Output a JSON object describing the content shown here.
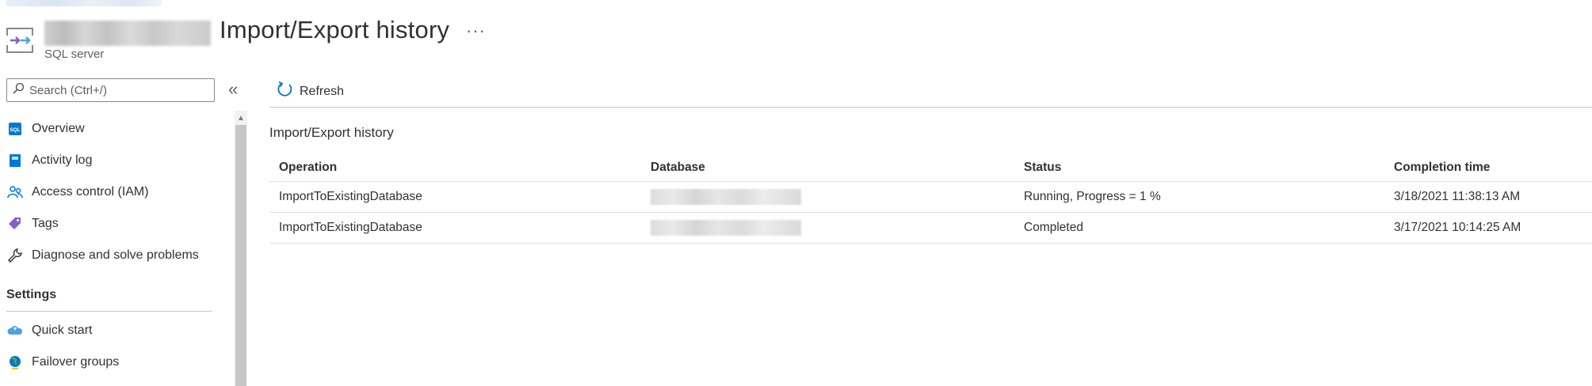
{
  "header": {
    "title": "Import/Export history",
    "resource_type": "SQL server",
    "more_label": "···"
  },
  "sidebar": {
    "search_placeholder": "Search (Ctrl+/)",
    "collapse_label": "«",
    "items": [
      {
        "label": "Overview",
        "icon": "sql-icon"
      },
      {
        "label": "Activity log",
        "icon": "activity-log-icon"
      },
      {
        "label": "Access control (IAM)",
        "icon": "people-icon"
      },
      {
        "label": "Tags",
        "icon": "tag-icon"
      },
      {
        "label": "Diagnose and solve problems",
        "icon": "wrench-icon"
      }
    ],
    "settings_heading": "Settings",
    "settings_items": [
      {
        "label": "Quick start",
        "icon": "cloud-icon"
      },
      {
        "label": "Failover groups",
        "icon": "globe-icon"
      }
    ]
  },
  "toolbar": {
    "refresh_label": "Refresh"
  },
  "history": {
    "section_title": "Import/Export history",
    "columns": [
      "Operation",
      "Database",
      "Status",
      "Completion time"
    ],
    "rows": [
      {
        "operation": "ImportToExistingDatabase",
        "status": "Running, Progress = 1 %",
        "completion_time": "3/18/2021 11:38:13 AM"
      },
      {
        "operation": "ImportToExistingDatabase",
        "status": "Completed",
        "completion_time": "3/17/2021 10:14:25 AM"
      }
    ]
  },
  "colors": {
    "accent": "#0078d4",
    "text": "#323130",
    "muted": "#605e5c"
  }
}
